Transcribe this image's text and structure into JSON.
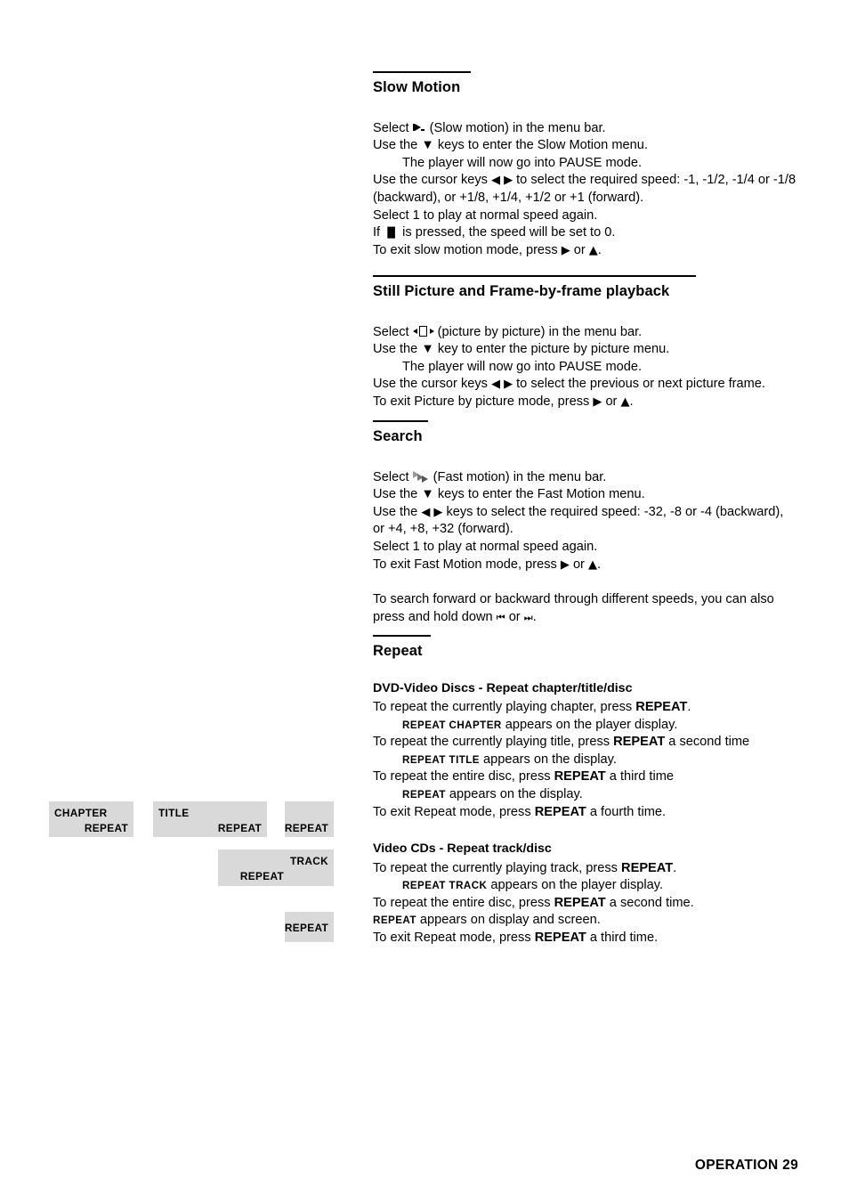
{
  "page": {
    "footer": "OPERATION 29"
  },
  "sections": {
    "slow_motion": {
      "heading": "Slow Motion",
      "lines": {
        "l1_pre": "Select ",
        "l1_post": " (Slow motion) in the menu bar.",
        "l2": "Use the ▼ keys to enter the Slow Motion menu.",
        "l3": "The player will now go into PAUSE mode.",
        "l4_a": "Use the cursor keys ",
        "l4_b": " to select the required speed: -1, -1/2, -1/4 or -1/8 (backward), or +1/8, +1/4, +1/2 or +1 (forward).",
        "l5": "Select 1 to play at normal speed again.",
        "l6_a": "If ",
        "l6_b": " is pressed, the speed will be set to 0.",
        "l7_a": "To exit slow motion mode, press ",
        "l7_b": " or ",
        "l7_c": "."
      }
    },
    "still_picture": {
      "heading": "Still Picture and Frame-by-frame playback",
      "lines": {
        "l1_pre": "Select ",
        "l1_post": " (picture by picture) in the menu bar.",
        "l2": "Use the ▼ key to enter the picture by picture menu.",
        "l3": "The player will now go into PAUSE mode.",
        "l4_a": "Use the cursor keys ",
        "l4_b": " to select the previous or next picture frame.",
        "l5_a": "To exit Picture by picture mode, press ",
        "l5_b": " or ",
        "l5_c": "."
      }
    },
    "search": {
      "heading": "Search",
      "lines": {
        "l1_pre": "Select ",
        "l1_post": " (Fast motion) in the menu bar.",
        "l2": "Use the ▼ keys to enter the Fast Motion menu.",
        "l3_a": "Use the ",
        "l3_b": " keys to select the required speed: -32, -8 or -4 (backward), or +4, +8, +32 (forward).",
        "l4": "Select 1 to play at normal speed again.",
        "l5_a": "To exit Fast Motion mode, press ",
        "l5_b": " or ",
        "l5_c": ".",
        "p2_a": "To search forward or backward through different speeds, you can also press and hold down ",
        "p2_b": " or ",
        "p2_c": "."
      }
    },
    "repeat": {
      "heading": "Repeat",
      "dvd": {
        "subheading": "DVD-Video Discs - Repeat chapter/title/disc",
        "l1_a": "To repeat the currently playing chapter, press ",
        "l1_b": "REPEAT",
        "l1_c": ".",
        "l2_a": "REPEAT CHAPTER",
        "l2_b": " appears on the player display.",
        "l3_a": "To repeat the currently playing title, press ",
        "l3_b": "REPEAT",
        "l3_c": " a second time",
        "l4_a": "REPEAT TITLE",
        "l4_b": " appears on the display.",
        "l5_a": "To repeat the entire disc, press ",
        "l5_b": "REPEAT",
        "l5_c": " a third time",
        "l6_a": "REPEAT",
        "l6_b": " appears on the display.",
        "l7_a": "To exit Repeat mode, press ",
        "l7_b": "REPEAT",
        "l7_c": " a fourth time."
      },
      "vcd": {
        "subheading": "Video CDs - Repeat track/disc",
        "l1_a": "To repeat the currently playing track, press ",
        "l1_b": "REPEAT",
        "l1_c": ".",
        "l2_a": "REPEAT TRACK",
        "l2_b": " appears on the player display.",
        "l3_a": "To repeat the entire disc, press ",
        "l3_b": "REPEAT",
        "l3_c": " a second time.",
        "l4_a": "REPEAT",
        "l4_b": " appears on display and screen.",
        "l5_a": "To exit Repeat mode, press ",
        "l5_b": "REPEAT",
        "l5_c": " a third time."
      }
    }
  },
  "display_boxes": [
    {
      "id": "chapter-repeat",
      "line1": "CHAPTER",
      "line2": "REPEAT"
    },
    {
      "id": "title-repeat",
      "line1": "TITLE",
      "line2": "REPEAT"
    },
    {
      "id": "repeat-disc",
      "line1": "",
      "line2": "REPEAT"
    },
    {
      "id": "track-repeat",
      "line1": "TRACK",
      "line2": "REPEAT"
    },
    {
      "id": "repeat-vcd",
      "line1": "",
      "line2": "REPEAT"
    }
  ],
  "icons": {
    "slow_motion": "slow-motion-icon",
    "picture_by_picture": "picture-by-picture-icon",
    "fast_motion": "fast-motion-icon",
    "cursor_left": "◀",
    "cursor_right": "▶",
    "cursor_up": "▲",
    "cursor_down": "▼",
    "pause": "▐▌",
    "skip_back": "⏮",
    "skip_forward": "⏭"
  },
  "colors": {
    "text": "#000000",
    "display_box_bg": "#d9d9d9",
    "page_bg": "#ffffff"
  }
}
